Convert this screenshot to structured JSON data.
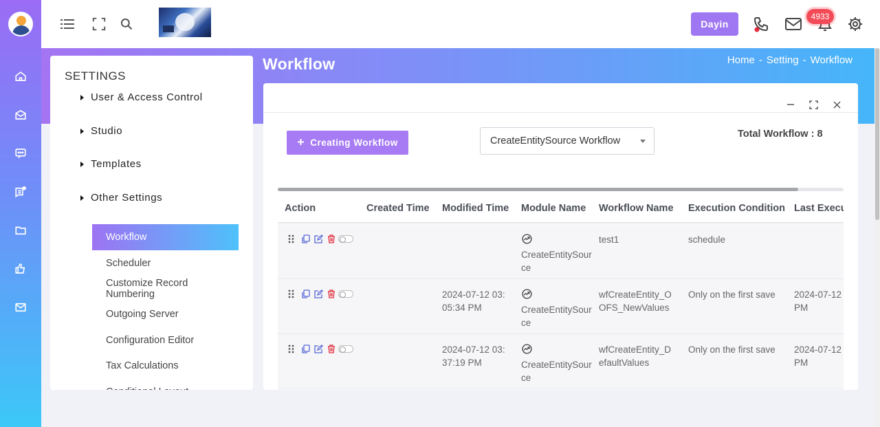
{
  "topbar": {
    "dayin_label": "Dayin",
    "notifications_count": "4933"
  },
  "hero": {
    "title": "Workflow",
    "breadcrumbs": [
      "Home",
      "-",
      "Setting",
      "-",
      "Workflow"
    ]
  },
  "settings": {
    "title": "SETTINGS",
    "groups": [
      "User & Access Control",
      "Studio",
      "Templates",
      "Other Settings"
    ],
    "items": [
      "Workflow",
      "Scheduler",
      "Customize Record Numbering",
      "Outgoing Server",
      "Configuration Editor",
      "Tax Calculations",
      "Conditional Layout"
    ]
  },
  "card": {
    "create_label": "Creating Workflow",
    "select_value": "CreateEntitySource Workflow",
    "total": "Total Workflow : 8",
    "columns": [
      "Action",
      "Created Time",
      "Modified Time",
      "Module Name",
      "Workflow Name",
      "Execution Condition",
      "Last Executed"
    ],
    "rows": [
      {
        "created": "",
        "modified": "",
        "module": "CreateEntitySource",
        "name": "test1",
        "condition": "schedule",
        "last": ""
      },
      {
        "created": "",
        "modified": "2024-07-12 03:05:34 PM",
        "module": "CreateEntitySource",
        "name": "wfCreateEntity_OOFS_NewValues",
        "condition": "Only on the first save",
        "last": "2024-07-12 PM"
      },
      {
        "created": "",
        "modified": "2024-07-12 03:37:19 PM",
        "module": "CreateEntitySource",
        "name": "wfCreateEntity_DefaultValues",
        "condition": "Only on the first save",
        "last": "2024-07-12 PM"
      }
    ]
  },
  "colors": {
    "accent": "#a077f2",
    "badge": "#f24b57",
    "gradient_start": "#a474f3",
    "gradient_end": "#45b6f9"
  },
  "icons": [
    "menu-icon",
    "fullscreen-icon",
    "search-icon",
    "phone-icon",
    "mail-icon",
    "bell-icon",
    "gear-icon",
    "home-icon",
    "inbox-icon",
    "chat-icon",
    "message-icon",
    "folder-icon",
    "thumbs-up-icon",
    "envelope-icon"
  ]
}
